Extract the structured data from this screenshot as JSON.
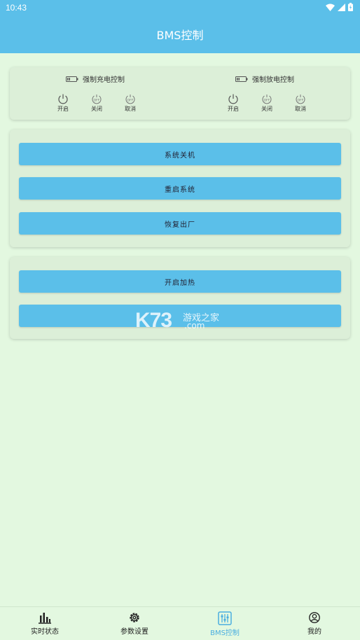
{
  "status": {
    "time": "10:43"
  },
  "header": {
    "title": "BMS控制"
  },
  "charge": {
    "title": "强制充电控制",
    "buttons": [
      {
        "label": "开启",
        "icon": "power-icon"
      },
      {
        "label": "关闭",
        "icon": "power-off-icon"
      },
      {
        "label": "取消",
        "icon": "power-off-icon"
      }
    ]
  },
  "discharge": {
    "title": "强制放电控制",
    "buttons": [
      {
        "label": "开启",
        "icon": "power-icon"
      },
      {
        "label": "关闭",
        "icon": "power-off-icon"
      },
      {
        "label": "取消",
        "icon": "power-off-icon"
      }
    ]
  },
  "system": {
    "shutdown": "系统关机",
    "restart": "重启系统",
    "factory_reset": "恢复出厂"
  },
  "heating": {
    "on": "开启加热",
    "off": ""
  },
  "watermark": {
    "brand": "K73",
    "text": "游戏之家",
    "domain": ".com"
  },
  "tabs": [
    {
      "label": "实时状态",
      "icon": "bar-chart-icon"
    },
    {
      "label": "参数设置",
      "icon": "gear-icon"
    },
    {
      "label": "BMS控制",
      "icon": "sliders-icon",
      "active": true
    },
    {
      "label": "我的",
      "icon": "user-icon"
    }
  ],
  "colors": {
    "primary": "#5bbfe9",
    "background": "#e3f8e0",
    "card": "#dcefd8",
    "active_tab": "#4aaee0"
  }
}
